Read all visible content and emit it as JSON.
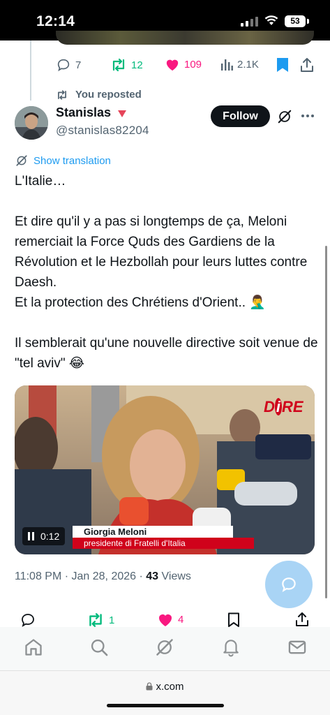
{
  "status_bar": {
    "time": "12:14",
    "battery": "53"
  },
  "prev_tweet_actions": {
    "replies": "7",
    "reposts": "12",
    "likes": "109",
    "views": "2.1K"
  },
  "repost_label": "You reposted",
  "author": {
    "display_name": "Stanislas",
    "handle": "@stanislas82204",
    "follow_label": "Follow"
  },
  "show_translation": "Show translation",
  "tweet_text": "L'Italie…\n\nEt dire qu'il y a pas si longtemps de ça, Meloni remerciait la Force Quds des Gardiens de la Révolution et le Hezbollah pour leurs luttes contre Daesh.\nEt la protection des Chrétiens d'Orient.. 🤦‍♂️\n\nIl semblerait qu'une nouvelle directive soit venue de \"tel aviv\" 😂",
  "video": {
    "logo_prefix": "D",
    "logo_highlight": "i",
    "logo_suffix": "RE",
    "lower_third_name": "Giorgia Meloni",
    "lower_third_role": "presidente di Fratelli d'Italia",
    "time": "0:12"
  },
  "meta": {
    "timestamp": "11:08 PM · Jan 28, 2026 · ",
    "views_count": "43",
    "views_label": " Views"
  },
  "tweet_actions": {
    "reposts": "1",
    "likes": "4"
  },
  "browser": {
    "url": "x.com"
  },
  "colors": {
    "accent": "#1d9bf0",
    "repost_green": "#00ba7c",
    "like_pink": "#f91880",
    "text": "#0f1419",
    "muted": "#536471"
  }
}
